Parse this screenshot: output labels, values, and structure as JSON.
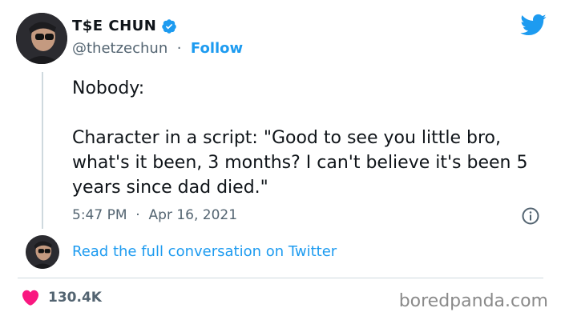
{
  "author": {
    "display_name": "T$E CHUN",
    "handle": "@thetzechun",
    "separator": "·",
    "follow_label": "Follow"
  },
  "tweet": {
    "line1": "Nobody:",
    "line2": "Character in a script: \"Good to see you little bro, what's it been, 3 months? I can't believe it's been 5 years since dad died.\"",
    "time": "5:47 PM",
    "date_separator": "·",
    "date": "Apr 16, 2021"
  },
  "conversation_link": "Read the full conversation on Twitter",
  "stats": {
    "likes": "130.4K"
  },
  "watermark": "boredpanda.com",
  "colors": {
    "accent": "#1d9bf0",
    "heart": "#f91880",
    "text": "#0f1419",
    "secondary": "#536471"
  },
  "icons": {
    "verified": "verified-badge-icon",
    "brand": "twitter-bird-icon",
    "info": "info-icon",
    "like": "heart-icon"
  }
}
